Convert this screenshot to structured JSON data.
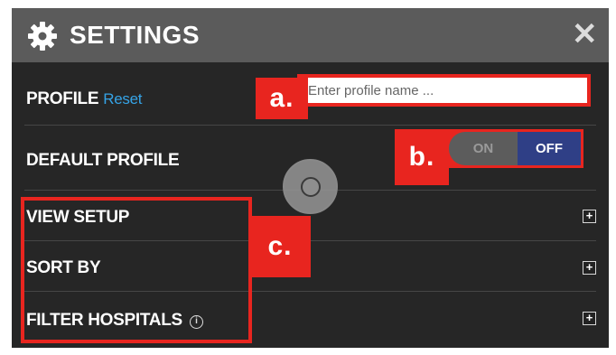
{
  "header": {
    "title": "SETTINGS",
    "settings_icon": "gear-icon",
    "close_glyph": "✕",
    "close_icon": "close-icon"
  },
  "profile": {
    "label": "PROFILE",
    "reset_label": "Reset",
    "input_placeholder": "Enter profile name ...",
    "input_value": ""
  },
  "default_profile": {
    "label": "DEFAULT PROFILE",
    "on_label": "ON",
    "off_label": "OFF",
    "selected": "OFF"
  },
  "sections": [
    {
      "label": "VIEW SETUP",
      "expand_glyph": "+"
    },
    {
      "label": "SORT BY",
      "expand_glyph": "+"
    },
    {
      "label": "FILTER HOSPITALS",
      "expand_glyph": "+",
      "info_glyph": "i"
    }
  ],
  "callouts": {
    "a": "a.",
    "b": "b.",
    "c": "c."
  },
  "colors": {
    "header_bg": "#5b5b5b",
    "panel_bg": "#262626",
    "accent_link": "#35a3e6",
    "annotation_red": "#e8251f",
    "toggle_off_bg": "#2f3f86"
  }
}
